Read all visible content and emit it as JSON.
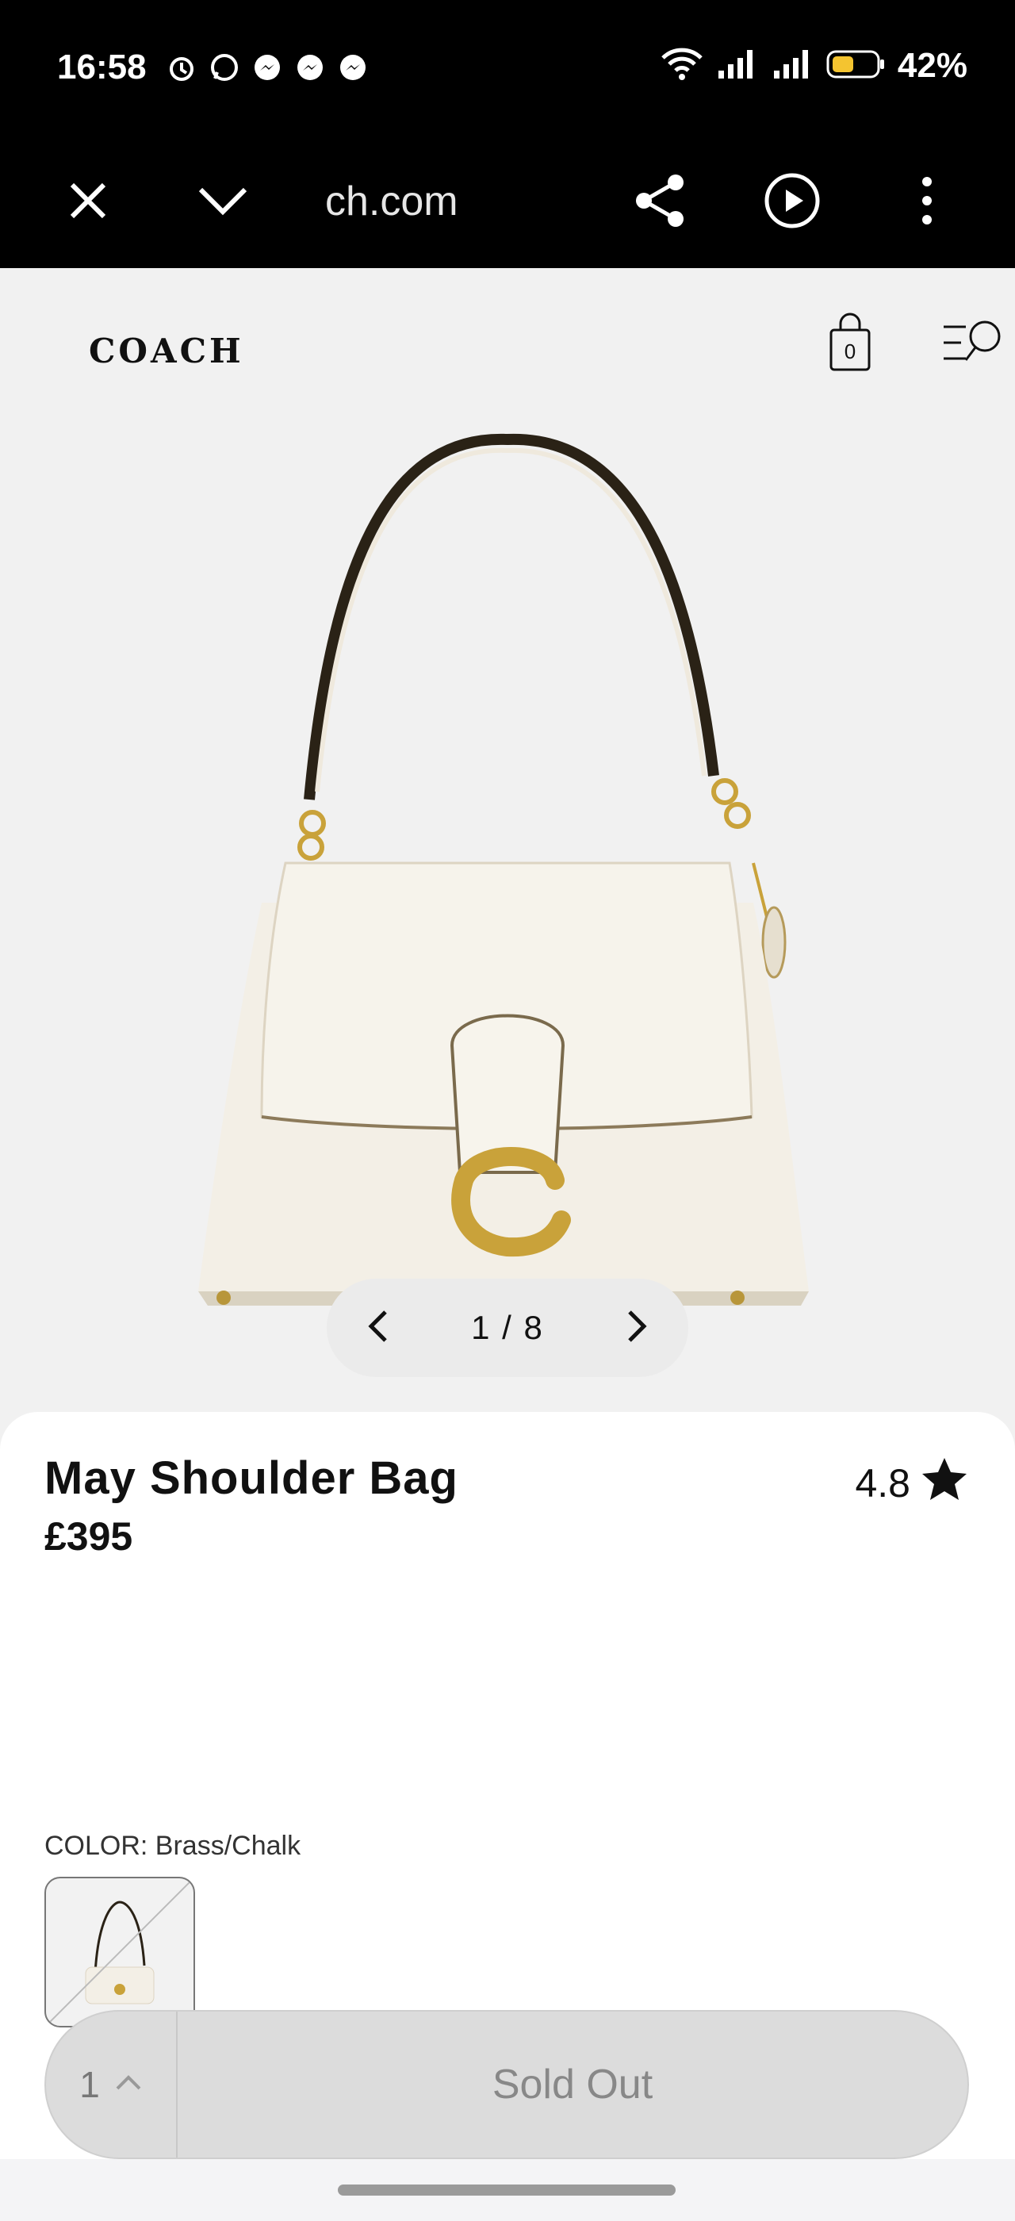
{
  "status_bar": {
    "time": "16:58",
    "battery": "42%",
    "notification_icons": [
      "alarm-icon",
      "whatsapp-icon",
      "messenger-icon",
      "messenger-icon",
      "messenger-icon"
    ]
  },
  "browser": {
    "url": "ch.com"
  },
  "site": {
    "logo": "COACH",
    "cart_count": "0"
  },
  "gallery": {
    "pager": "1 / 8"
  },
  "product": {
    "name": "May Shoulder Bag",
    "price": "£395",
    "rating": "4.8",
    "color_label": "COLOR: Brass/Chalk"
  },
  "purchase": {
    "quantity": "1",
    "button_label": "Sold Out"
  },
  "colors": {
    "accent_gold": "#c9a23a",
    "bag_body": "#f1ede4",
    "disabled_bg": "#dcdcdc"
  }
}
